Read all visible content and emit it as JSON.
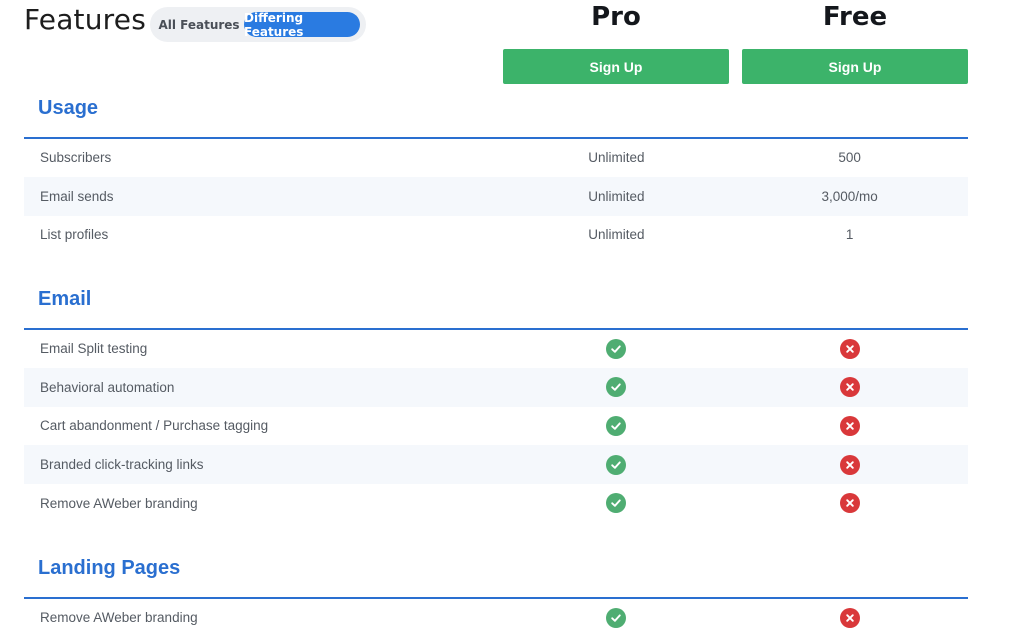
{
  "header": {
    "title": "Features",
    "toggle": {
      "all_label": "All Features",
      "differing_label": "Differing Features"
    },
    "plans": [
      {
        "name": "Pro",
        "cta": "Sign Up"
      },
      {
        "name": "Free",
        "cta": "Sign Up"
      }
    ]
  },
  "colors": {
    "accent": "#2a7be1",
    "section": "#2a6fd0",
    "cta": "#3cb36a",
    "yes": "#4fad72",
    "no": "#d9383a"
  },
  "sections": {
    "usage": {
      "title": "Usage",
      "rows": [
        {
          "feature": "Subscribers",
          "pro": "Unlimited",
          "free": "500"
        },
        {
          "feature": "Email sends",
          "pro": "Unlimited",
          "free": "3,000/mo"
        },
        {
          "feature": "List profiles",
          "pro": "Unlimited",
          "free": "1"
        }
      ]
    },
    "email": {
      "title": "Email",
      "rows": [
        {
          "feature": "Email Split testing",
          "pro": "check-icon",
          "free": "x-icon"
        },
        {
          "feature": "Behavioral automation",
          "pro": "check-icon",
          "free": "x-icon"
        },
        {
          "feature": "Cart abandonment / Purchase tagging",
          "pro": "check-icon",
          "free": "x-icon"
        },
        {
          "feature": "Branded click-tracking links",
          "pro": "check-icon",
          "free": "x-icon"
        },
        {
          "feature": "Remove AWeber branding",
          "pro": "check-icon",
          "free": "x-icon"
        }
      ]
    },
    "landing": {
      "title": "Landing Pages",
      "rows": [
        {
          "feature": "Remove AWeber branding",
          "pro": "check-icon",
          "free": "x-icon"
        }
      ]
    }
  }
}
